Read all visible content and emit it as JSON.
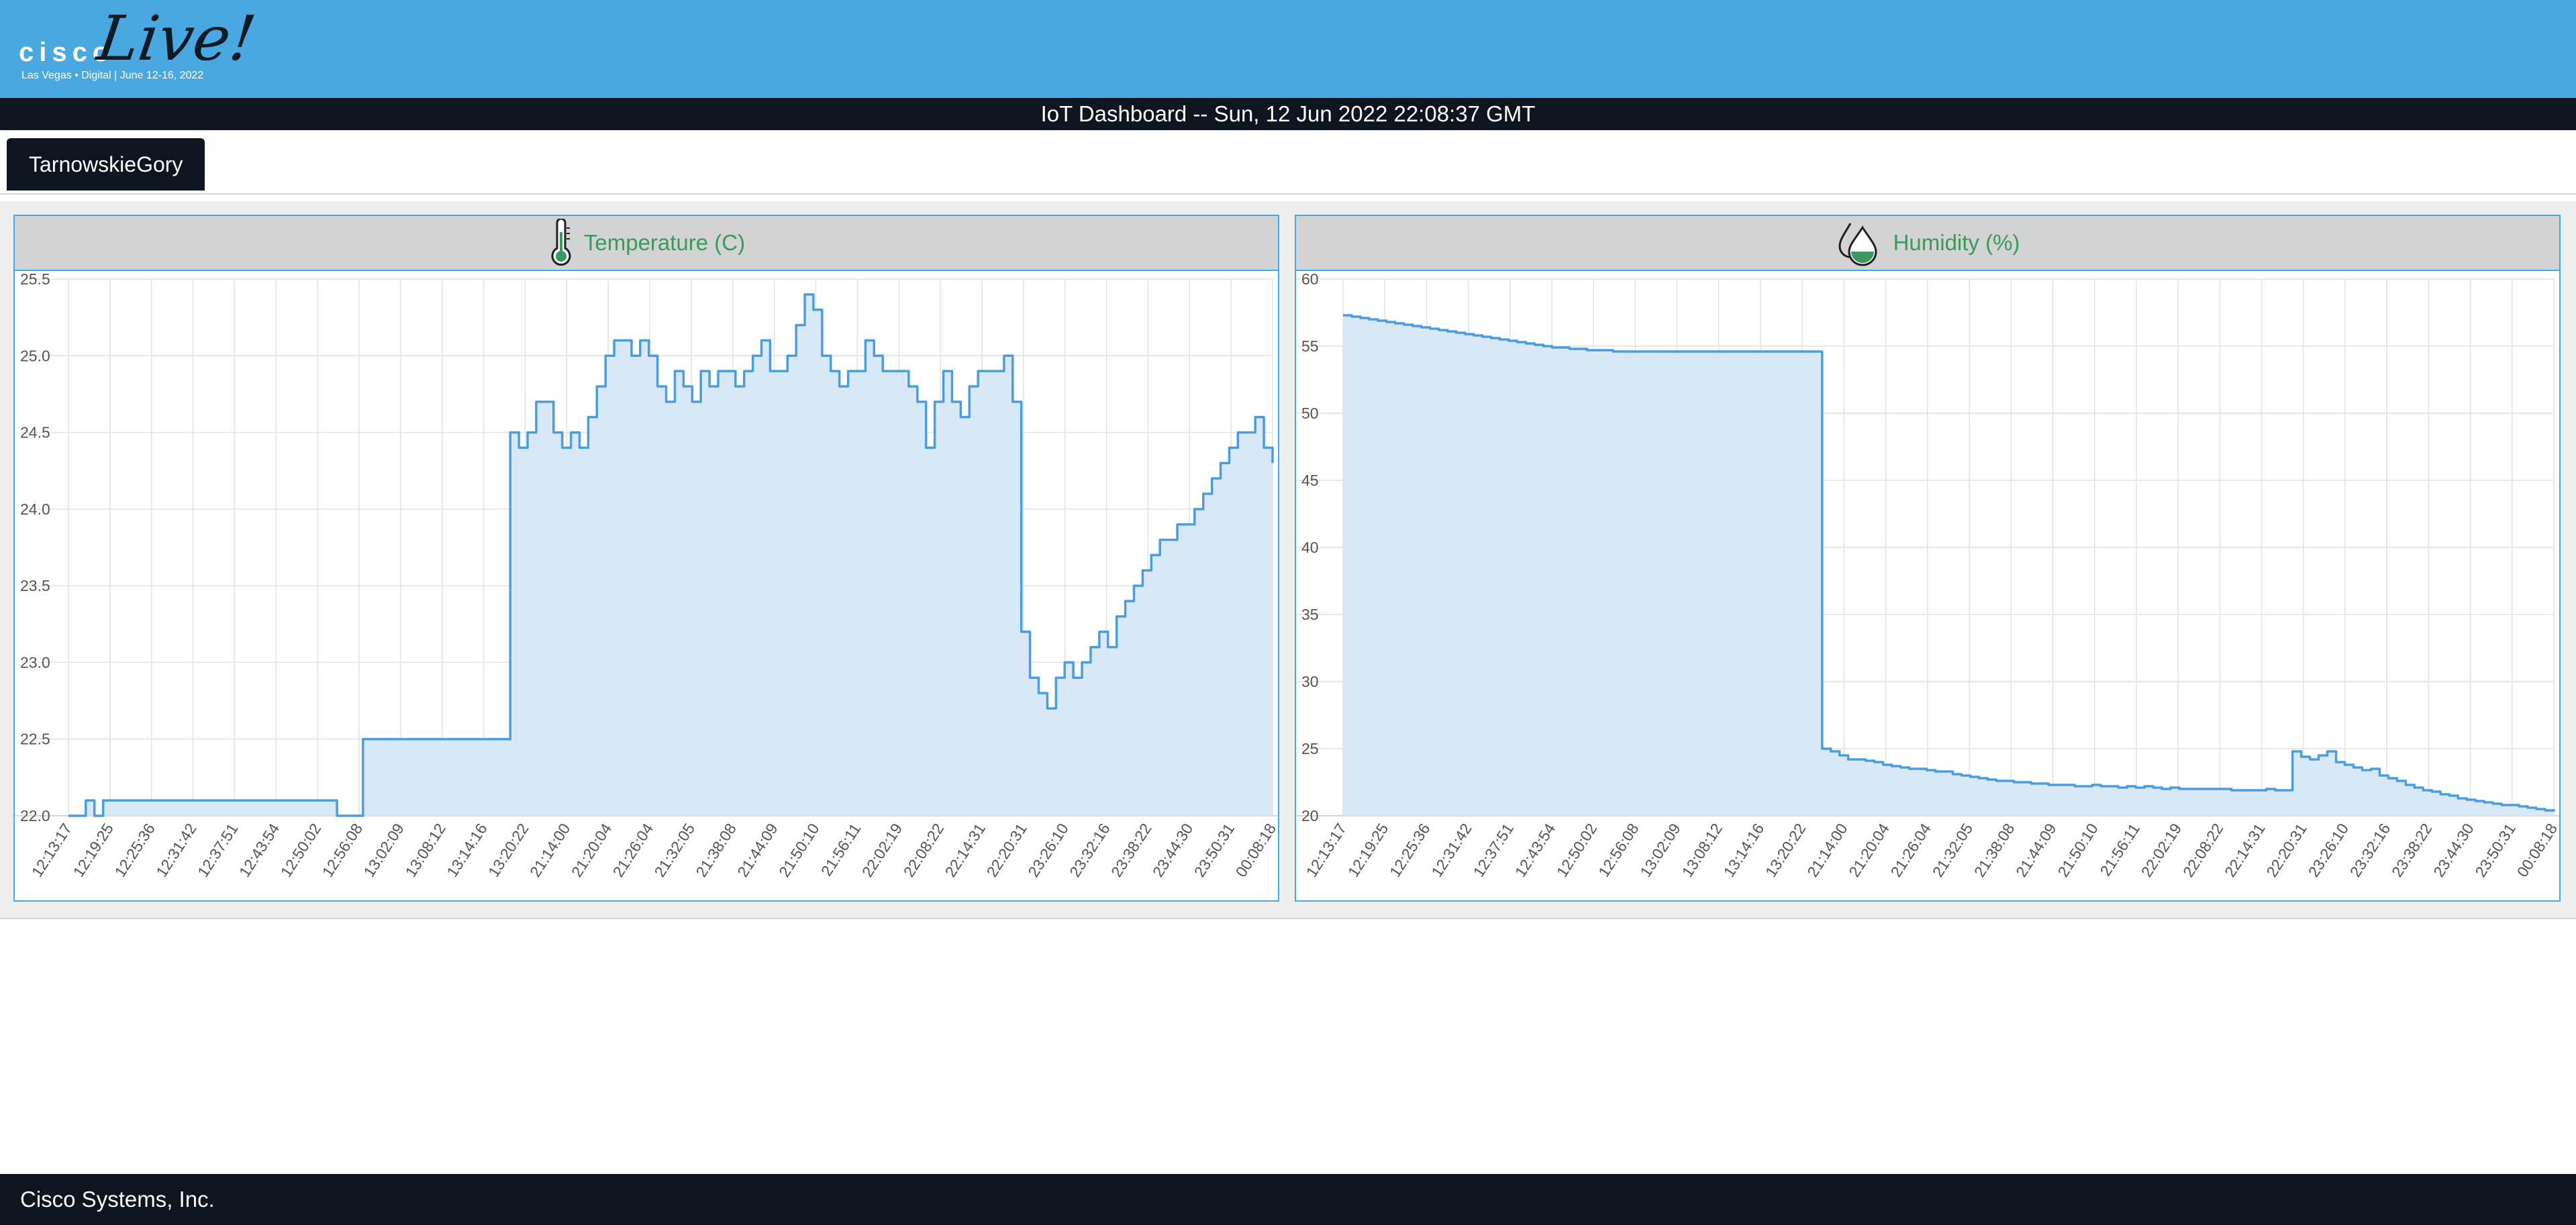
{
  "header": {
    "logo": {
      "brand": "cisco",
      "event": "Live!",
      "subtitle": "Las Vegas • Digital | June 12-16, 2022"
    },
    "title": "IoT Dashboard -- Sun, 12 Jun 2022 22:08:37 GMT"
  },
  "tabs": [
    {
      "label": "TarnowskieGory",
      "active": true
    }
  ],
  "colors": {
    "accent": "#4aa8e0",
    "line": "#4a9de0",
    "fill": "#d9e8f7",
    "title_green": "#3a9a5b",
    "dark": "#0d1620"
  },
  "footer": {
    "text": "Cisco Systems, Inc."
  },
  "chart_data": [
    {
      "type": "area",
      "title": "Temperature (C)",
      "icon": "thermometer-icon",
      "ylim": [
        22.0,
        25.5
      ],
      "yticks": [
        "25.5",
        "25.0",
        "24.5",
        "24.0",
        "23.5",
        "23.0",
        "22.5",
        "22.0"
      ],
      "x": [
        "12:13:17",
        "12:19:25",
        "12:25:36",
        "12:31:42",
        "12:37:51",
        "12:43:54",
        "12:50:02",
        "12:56:08",
        "13:02:09",
        "13:08:12",
        "13:14:16",
        "13:20:22",
        "21:14:00",
        "21:20:04",
        "21:26:04",
        "21:32:05",
        "21:38:08",
        "21:44:09",
        "21:50:10",
        "21:56:11",
        "22:02:19",
        "22:08:22",
        "22:14:31",
        "22:20:31",
        "23:26:10",
        "23:32:16",
        "23:38:22",
        "23:44:30",
        "23:50:31",
        "00:08:18"
      ],
      "values": [
        22.0,
        22.0,
        22.1,
        22.0,
        22.1,
        22.1,
        22.1,
        22.1,
        22.1,
        22.1,
        22.1,
        22.1,
        22.1,
        22.1,
        22.1,
        22.1,
        22.1,
        22.1,
        22.1,
        22.1,
        22.1,
        22.1,
        22.1,
        22.1,
        22.1,
        22.1,
        22.1,
        22.1,
        22.1,
        22.1,
        22.1,
        22.0,
        22.0,
        22.0,
        22.5,
        22.5,
        22.5,
        22.5,
        22.5,
        22.5,
        22.5,
        22.5,
        22.5,
        22.5,
        22.5,
        22.5,
        22.5,
        22.5,
        22.5,
        22.5,
        22.5,
        24.5,
        24.4,
        24.5,
        24.7,
        24.7,
        24.5,
        24.4,
        24.5,
        24.4,
        24.6,
        24.8,
        25.0,
        25.1,
        25.1,
        25.0,
        25.1,
        25.0,
        24.8,
        24.7,
        24.9,
        24.8,
        24.7,
        24.9,
        24.8,
        24.9,
        24.9,
        24.8,
        24.9,
        25.0,
        25.1,
        24.9,
        24.9,
        25.0,
        25.2,
        25.4,
        25.3,
        25.0,
        24.9,
        24.8,
        24.9,
        24.9,
        25.1,
        25.0,
        24.9,
        24.9,
        24.9,
        24.8,
        24.7,
        24.4,
        24.7,
        24.9,
        24.7,
        24.6,
        24.8,
        24.9,
        24.9,
        24.9,
        25.0,
        24.7,
        23.2,
        22.9,
        22.8,
        22.7,
        22.9,
        23.0,
        22.9,
        23.0,
        23.1,
        23.2,
        23.1,
        23.3,
        23.4,
        23.5,
        23.6,
        23.7,
        23.8,
        23.8,
        23.9,
        23.9,
        24.0,
        24.1,
        24.2,
        24.3,
        24.4,
        24.5,
        24.5,
        24.6,
        24.4,
        24.3
      ]
    },
    {
      "type": "area",
      "title": "Humidity (%)",
      "icon": "humidity-drops-icon",
      "ylim": [
        20,
        60
      ],
      "yticks": [
        "60",
        "55",
        "50",
        "45",
        "40",
        "35",
        "30",
        "25",
        "20"
      ],
      "x": [
        "12:13:17",
        "12:19:25",
        "12:25:36",
        "12:31:42",
        "12:37:51",
        "12:43:54",
        "12:50:02",
        "12:56:08",
        "13:02:09",
        "13:08:12",
        "13:14:16",
        "13:20:22",
        "21:14:00",
        "21:20:04",
        "21:26:04",
        "21:32:05",
        "21:38:08",
        "21:44:09",
        "21:50:10",
        "21:56:11",
        "22:02:19",
        "22:08:22",
        "22:14:31",
        "22:20:31",
        "23:26:10",
        "23:32:16",
        "23:38:22",
        "23:44:30",
        "23:50:31",
        "00:08:18"
      ],
      "values": [
        57.3,
        57.2,
        57.1,
        57.0,
        56.9,
        56.8,
        56.7,
        56.6,
        56.5,
        56.4,
        56.3,
        56.2,
        56.1,
        56.0,
        55.9,
        55.8,
        55.7,
        55.6,
        55.5,
        55.4,
        55.3,
        55.2,
        55.1,
        55.0,
        54.9,
        54.9,
        54.8,
        54.8,
        54.7,
        54.7,
        54.7,
        54.6,
        54.6,
        54.6,
        54.6,
        54.6,
        54.6,
        54.6,
        54.6,
        54.6,
        54.6,
        54.6,
        54.6,
        54.6,
        54.6,
        54.6,
        54.6,
        54.6,
        54.6,
        54.6,
        54.6,
        54.6,
        54.6,
        54.6,
        54.6,
        25.0,
        24.8,
        24.5,
        24.2,
        24.2,
        24.1,
        24.0,
        23.8,
        23.7,
        23.6,
        23.5,
        23.5,
        23.4,
        23.3,
        23.3,
        23.1,
        23.0,
        22.9,
        22.8,
        22.7,
        22.6,
        22.6,
        22.5,
        22.5,
        22.4,
        22.4,
        22.3,
        22.3,
        22.3,
        22.2,
        22.2,
        22.3,
        22.2,
        22.2,
        22.1,
        22.2,
        22.1,
        22.2,
        22.1,
        22.0,
        22.1,
        22.0,
        22.0,
        22.0,
        22.0,
        22.0,
        22.0,
        21.9,
        21.9,
        21.9,
        21.9,
        22.0,
        21.9,
        21.9,
        24.8,
        24.4,
        24.2,
        24.5,
        24.8,
        24.0,
        23.8,
        23.6,
        23.4,
        23.5,
        23.0,
        22.8,
        22.6,
        22.3,
        22.1,
        21.9,
        21.8,
        21.6,
        21.5,
        21.3,
        21.2,
        21.1,
        21.0,
        20.9,
        20.8,
        20.8,
        20.7,
        20.6,
        20.5,
        20.4,
        20.5
      ]
    }
  ]
}
